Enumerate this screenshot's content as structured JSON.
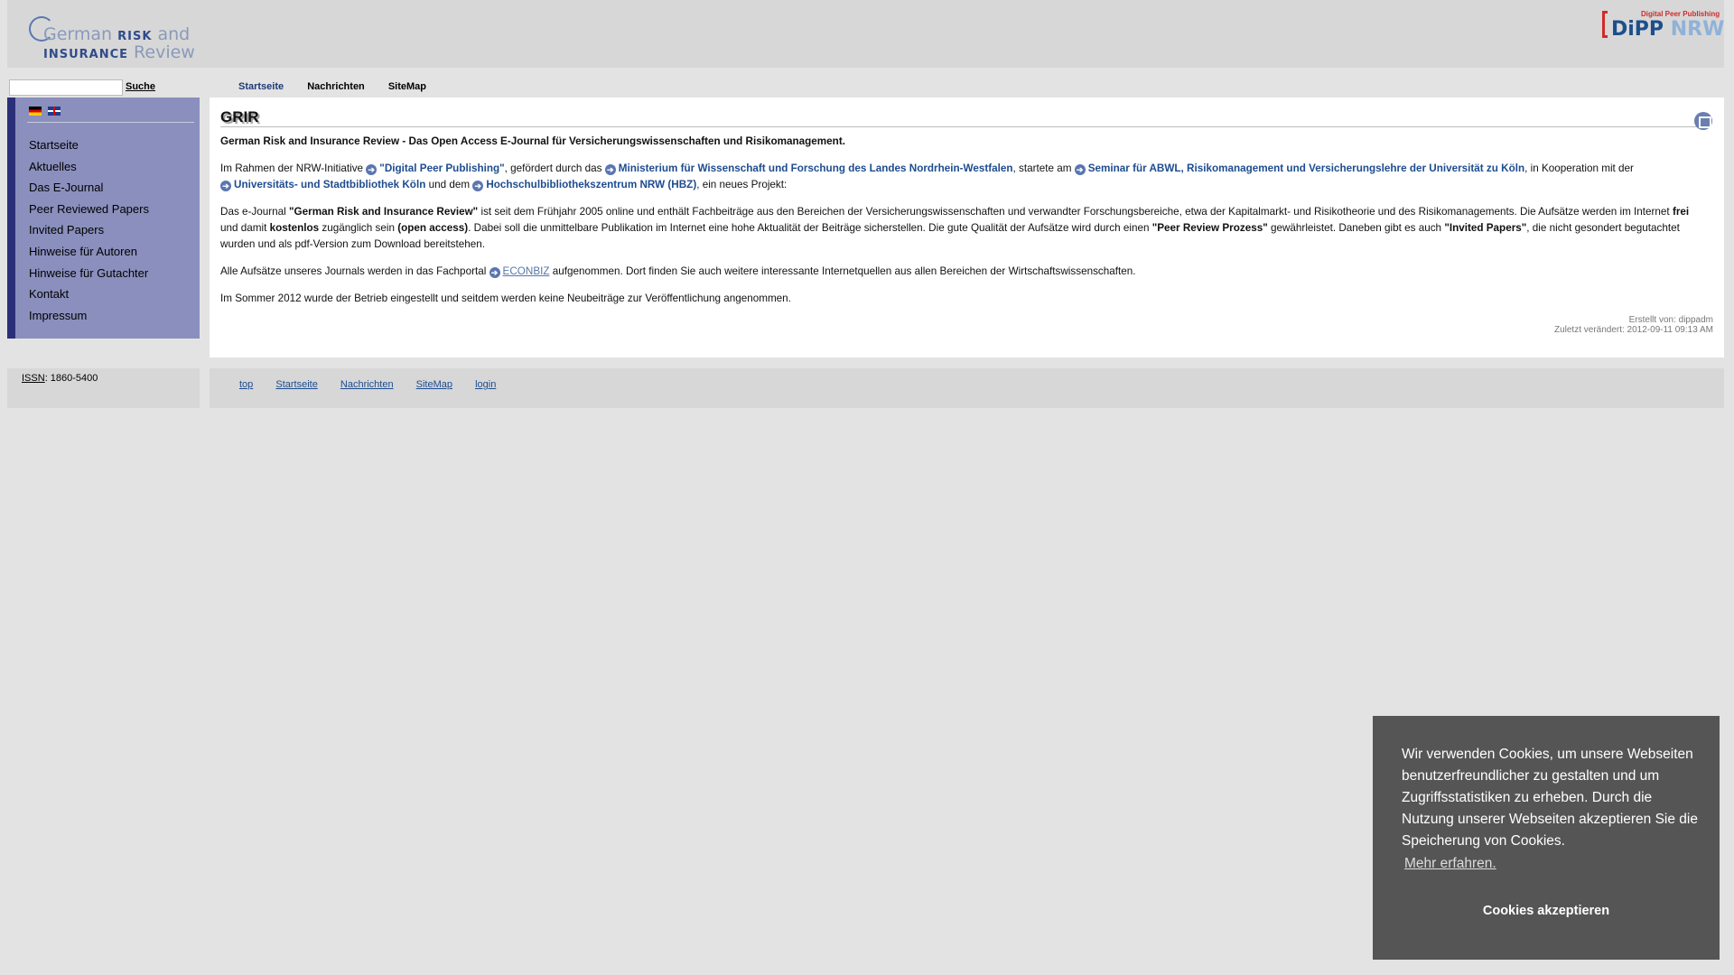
{
  "header": {
    "logo_left": {
      "line1_a": "German ",
      "line1_b": "RISK",
      "line1_c": " and",
      "line2_a": "INSURANCE",
      "line2_b": " Review"
    },
    "logo_right": {
      "tagline": "Digital Peer Publishing",
      "dipp": "DiPP",
      "nrw": " NRW"
    }
  },
  "search": {
    "placeholder": "",
    "button": "Suche"
  },
  "topnav": {
    "items": [
      "Startseite",
      "Nachrichten",
      "SiteMap"
    ],
    "active": "Startseite"
  },
  "sidebar": {
    "items": [
      "Startseite",
      "Aktuelles",
      "Das E-Journal",
      "Peer Reviewed Papers",
      "Invited Papers",
      "Hinweise für Autoren",
      "Hinweise für Gutachter",
      "Kontakt",
      "Impressum"
    ]
  },
  "content": {
    "title": "GRIR",
    "lead": "German Risk and Insurance Review - Das Open Access E-Journal für Versicherungswissenschaften und Risikomanagement.",
    "p1": {
      "t1": "Im Rahmen der NRW-Initiative ",
      "link1": "\"Digital Peer Publishing\"",
      "t2": ", gefördert durch das ",
      "link2": "Ministerium für Wissenschaft und Forschung des Landes Nordrhein-Westfalen",
      "t3": ", startete am ",
      "link3": "Seminar für ABWL, Risikomanagement und Versicherungslehre der Universität zu Köln",
      "t4": ", in Kooperation mit der ",
      "link4": "Universitäts- und Stadtbibliothek Köln",
      "t5": " und dem ",
      "link5": "Hochschulbibliothekszentrum NRW (HBZ)",
      "t6": ", ein neues Projekt:"
    },
    "p2": {
      "t1": "Das e-Journal ",
      "b1": "\"German Risk and Insurance Review\"",
      "t2": " ist seit dem Frühjahr 2005 online und enthält Fachbeiträge aus den Bereichen der Versicherungswissenschaften und verwandter Forschungsbereiche, etwa der Kapitalmarkt- und Risikotheorie und des Risikomanagements. Die Aufsätze werden im Internet ",
      "b2": "frei",
      "t3": " und damit ",
      "b3": "kostenlos",
      "t4": " zugänglich sein ",
      "b4": "(open access)",
      "t5": ". Dabei soll die unmittelbare Publikation im Internet eine hohe Aktualität der Beiträge sicherstellen. Die gute Qualität der Aufsätze wird durch einen ",
      "b5": "\"Peer Review Prozess\"",
      "t6": " gewährleistet. Daneben gibt es auch ",
      "b6": "\"Invited Papers\"",
      "t7": ", die nicht gesondert begutachtet wurden und als pdf-Version zum Download bereitstehen."
    },
    "p3": {
      "t1": "Alle Aufsätze unseres Journals werden in das Fachportal ",
      "link1": "ECONBIZ",
      "t2": " aufgenommen. Dort finden Sie auch weitere interessante Internetquellen aus allen Bereichen der Wirtschaftswissenschaften."
    },
    "p4": "Im Sommer 2012 wurde der Betrieb eingestellt und seitdem werden keine Neubeiträge zur Veröffentlichung angenommen.",
    "meta": {
      "created": "Erstellt von: dippadm",
      "modified": "Zuletzt verändert: 2012-09-11 09:13 AM"
    }
  },
  "footer": {
    "issn_label": "ISSN",
    "issn_value": ": 1860-5400",
    "links": [
      "top",
      "Startseite",
      "Nachrichten",
      "SiteMap",
      "login"
    ]
  },
  "cookie": {
    "text": "Wir verwenden Cookies, um unsere Webseiten benutzerfreundlicher zu gestalten und um Zugriffsstatistiken zu erheben. Durch die Nutzung unserer Webseiten akzeptieren Sie die Speicherung von Cookies.",
    "more": "Mehr erfahren.",
    "accept": "Cookies akzeptieren"
  }
}
